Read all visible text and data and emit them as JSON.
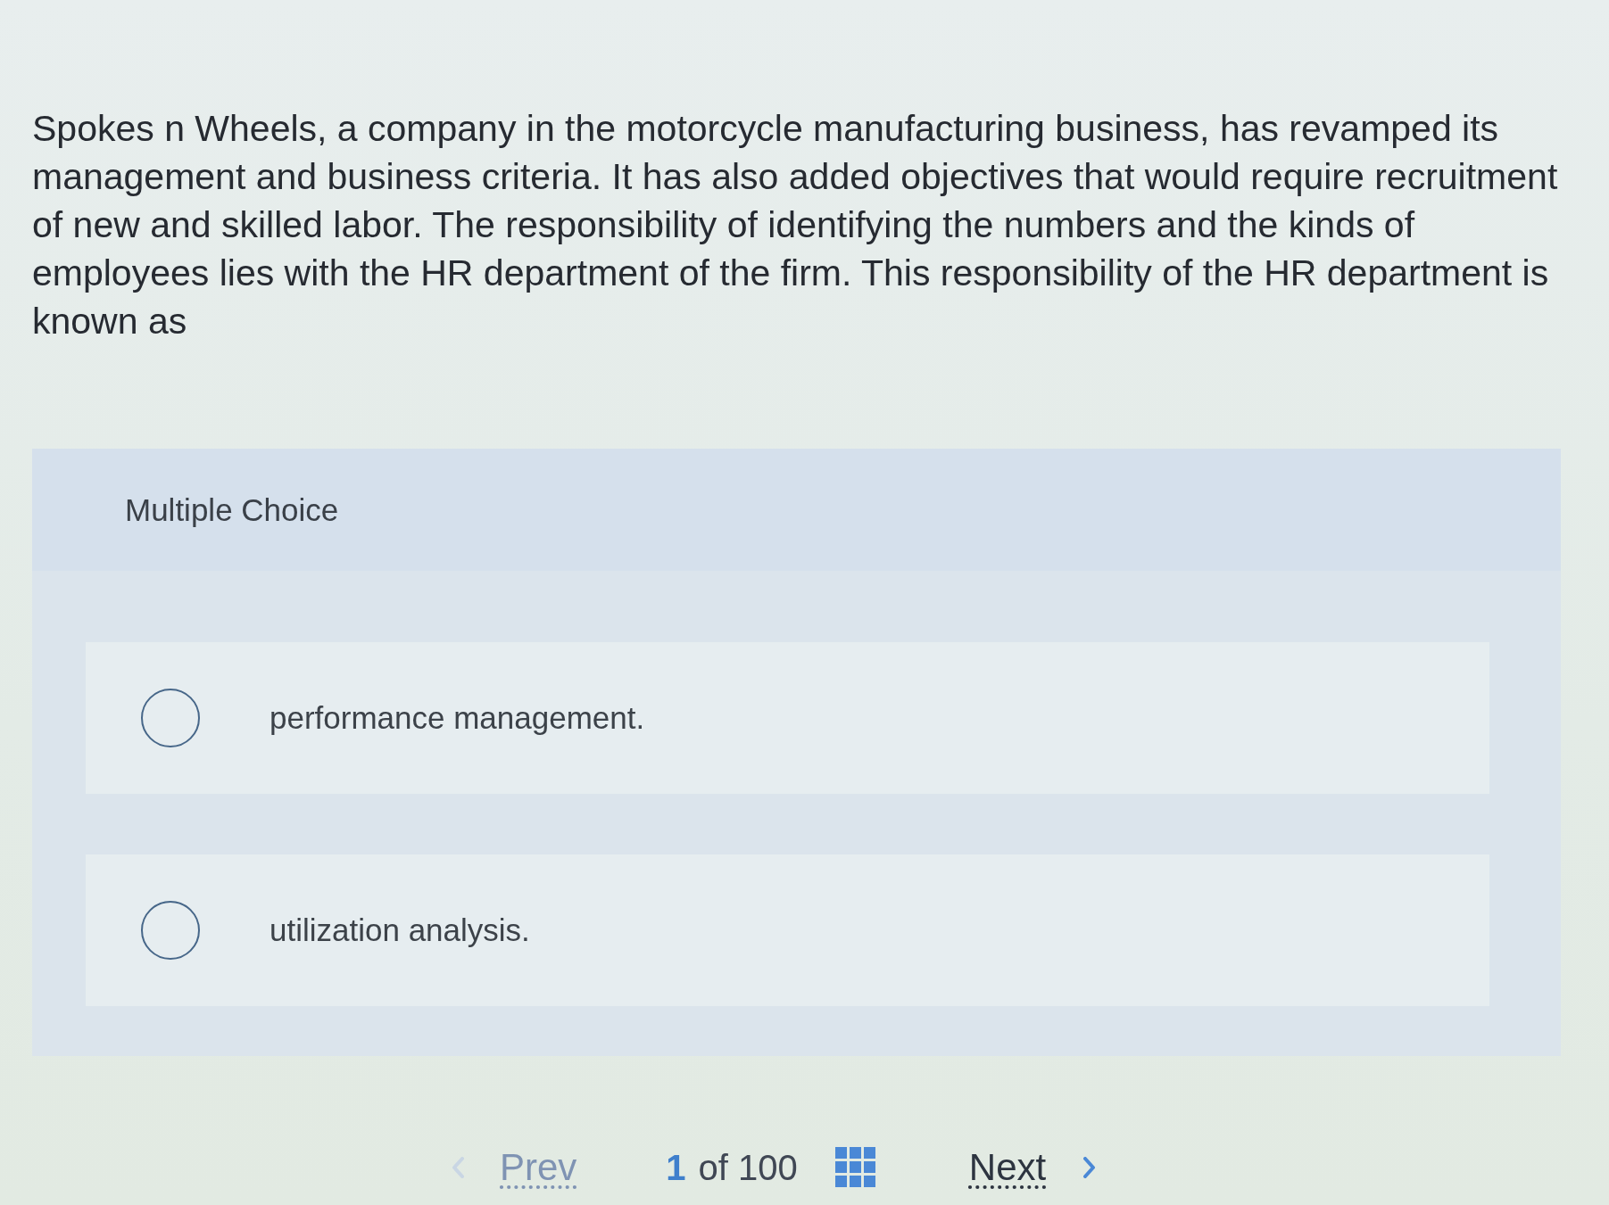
{
  "question": {
    "text": "Spokes n Wheels, a company in the motorcycle manufacturing business, has revamped its management and business criteria. It has also added objectives that would require recruitment of new and skilled labor. The responsibility of identifying the numbers and the kinds of employees lies with the HR department of the firm. This responsibility of the HR department is known as"
  },
  "answer_panel": {
    "heading": "Multiple Choice",
    "options": [
      {
        "label": "performance management.",
        "selected": false
      },
      {
        "label": "utilization analysis.",
        "selected": false
      }
    ]
  },
  "pager": {
    "prev": {
      "label": "Prev",
      "disabled": true
    },
    "current": "1",
    "total": "of 100",
    "next": {
      "label": "Next",
      "disabled": false
    }
  }
}
